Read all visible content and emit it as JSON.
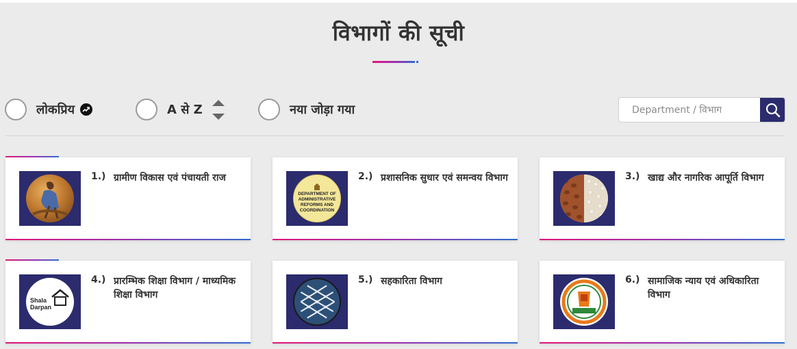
{
  "page": {
    "title": "विभागों की सूची"
  },
  "filters": {
    "popular_label": "लोकप्रिय",
    "popular_icon": "trending-up-icon",
    "az_label": "A से Z",
    "az_icon": "sort-updown-icon",
    "new_label": "नया जोड़ा गया"
  },
  "search": {
    "placeholder": "Department / विभाग",
    "value": "",
    "icon": "search-icon"
  },
  "departments": [
    {
      "num": "1.)",
      "name": "ग्रामीण विकास एवं पंचायती राज",
      "logo": "rural-development-logo"
    },
    {
      "num": "2.)",
      "name": "प्रशासनिक सुधार एवं समन्वय विभाग",
      "logo": "administrative-reforms-logo",
      "logo_text": "DEPARTMENT OF ADMINISTRATIVE REFORMS AND COORDINATION"
    },
    {
      "num": "3.)",
      "name": "खाद्य और नागरिक आपूर्ति विभाग",
      "logo": "food-supply-logo"
    },
    {
      "num": "4.)",
      "name": "प्रारम्भिक शिक्षा विभाग / माध्यमिक शिक्षा विभाग",
      "logo": "shala-darpan-logo",
      "logo_text": "Shala Darpan"
    },
    {
      "num": "5.)",
      "name": "सहकारिता विभाग",
      "logo": "cooperative-logo"
    },
    {
      "num": "6.)",
      "name": "सामाजिक न्याय एवं अधिकारिता विभाग",
      "logo": "social-justice-logo"
    }
  ],
  "colors": {
    "accent_pink": "#e0177b",
    "accent_purple": "#9b2fae",
    "accent_blue": "#2f6bcf",
    "navy": "#2b2b6e",
    "background": "#ebebeb"
  }
}
